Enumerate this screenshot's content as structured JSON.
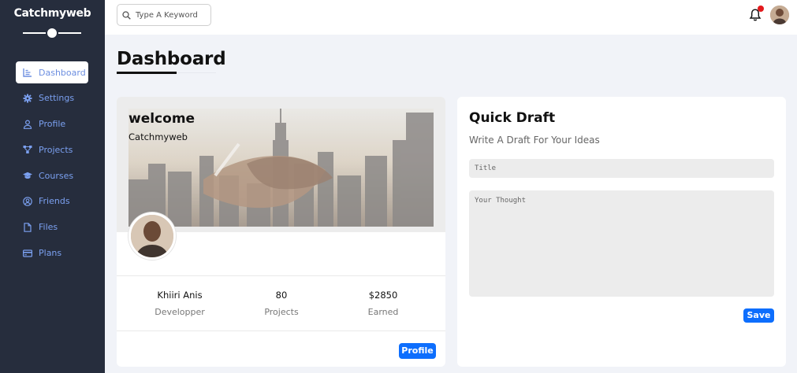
{
  "brand": "Catchmyweb",
  "sidebar": {
    "items": [
      {
        "label": "Dashboard",
        "icon": "chart-icon"
      },
      {
        "label": "Settings",
        "icon": "gear-icon"
      },
      {
        "label": "Profile",
        "icon": "user-icon"
      },
      {
        "label": "Projects",
        "icon": "diagram-icon"
      },
      {
        "label": "Courses",
        "icon": "graduation-cap-icon"
      },
      {
        "label": "Friends",
        "icon": "user-circle-icon"
      },
      {
        "label": "Files",
        "icon": "file-icon"
      },
      {
        "label": "Plans",
        "icon": "credit-card-icon"
      }
    ]
  },
  "header": {
    "search_placeholder": "Type A Keyword",
    "notification_dot_color": "#e3191c"
  },
  "page": {
    "title": "Dashboard"
  },
  "welcome": {
    "title": "welcome",
    "subtitle": "Catchmyweb",
    "stats": [
      {
        "value": "Khiiri Anis",
        "label": "Developper"
      },
      {
        "value": "80",
        "label": "Projects"
      },
      {
        "value": "$2850",
        "label": "Earned"
      }
    ],
    "button": "Profile"
  },
  "draft": {
    "title": "Quick Draft",
    "subtitle": "Write A Draft For Your Ideas",
    "title_placeholder": "Title",
    "thought_placeholder": "Your Thought",
    "button": "Save"
  },
  "colors": {
    "sidebar_bg": "#262d3d",
    "accent": "#0d6efd",
    "nav_text": "#7ba0f0"
  }
}
